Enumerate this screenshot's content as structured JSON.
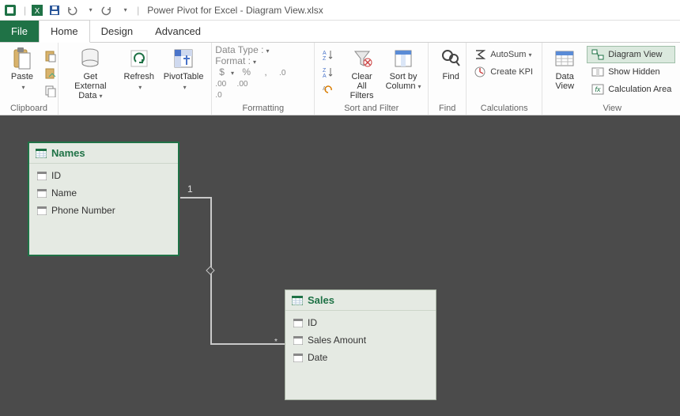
{
  "titlebar": {
    "app_title": "Power Pivot for Excel - Diagram View.xlsx",
    "sep": "|"
  },
  "tabs": {
    "file": "File",
    "home": "Home",
    "design": "Design",
    "advanced": "Advanced"
  },
  "ribbon": {
    "clipboard": {
      "paste": "Paste",
      "label": "Clipboard"
    },
    "getdata": {
      "get_external_top": "Get External",
      "get_external_bottom": "Data",
      "refresh": "Refresh",
      "pivottable": "PivotTable"
    },
    "formatting": {
      "data_type": "Data Type :",
      "format": "Format :",
      "currency": "$",
      "percent": "%",
      "comma": ",",
      "inc": "⁺⁰",
      "dec": "⁻⁰",
      "label": "Formatting"
    },
    "sortfilter": {
      "sort_asc": "A→Z",
      "sort_desc": "Z→A",
      "clear_sort": "⟲",
      "clear_filters_top": "Clear All",
      "clear_filters_bottom": "Filters",
      "sortby_top": "Sort by",
      "sortby_bottom": "Column",
      "label": "Sort and Filter"
    },
    "find": {
      "find": "Find",
      "label": "Find"
    },
    "calculations": {
      "autosum": "AutoSum",
      "createkpi": "Create KPI",
      "label": "Calculations"
    },
    "view": {
      "dataview_top": "Data",
      "dataview_bottom": "View",
      "diagram_view": "Diagram View",
      "show_hidden": "Show Hidden",
      "calc_area": "Calculation Area",
      "label": "View"
    }
  },
  "diagram": {
    "tables": {
      "names": {
        "title": "Names",
        "fields": {
          "id": "ID",
          "name": "Name",
          "phone": "Phone Number"
        }
      },
      "sales": {
        "title": "Sales",
        "fields": {
          "id": "ID",
          "amount": "Sales Amount",
          "date": "Date"
        }
      }
    },
    "rel": {
      "one": "1",
      "many": "*"
    }
  }
}
